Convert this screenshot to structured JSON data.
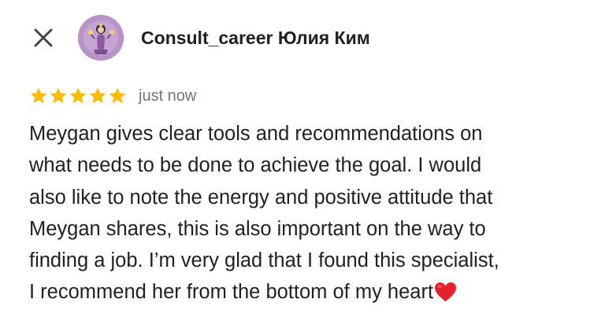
{
  "header": {
    "close_icon": "close-icon",
    "author_name": "Consult_career Юлия Ким",
    "avatar": "avatar-image"
  },
  "review": {
    "rating": 5,
    "rating_max": 5,
    "star_color": "#fbbc04",
    "time": "just now",
    "lines": [
      "Meygan gives clear tools and recommendations on",
      "what needs to be done to achieve the goal. I would",
      "also like to note the energy and positive attitude that",
      "Meygan shares, this is also important on the way to",
      "finding a job. I’m very glad that I found this specialist,",
      "I recommend her from the bottom of my heart"
    ],
    "emoji": "heart-icon"
  }
}
